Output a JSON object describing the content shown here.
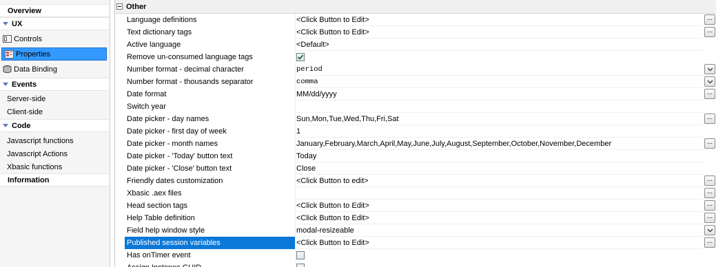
{
  "sidebar": {
    "items": [
      {
        "label": "Overview",
        "kind": "header"
      },
      {
        "label": "UX",
        "kind": "group"
      },
      {
        "label": "Controls",
        "kind": "item",
        "icon": "controls-icon"
      },
      {
        "label": "Properties",
        "kind": "item",
        "icon": "properties-icon",
        "selected": true
      },
      {
        "label": "Data Binding",
        "kind": "item",
        "icon": "database-icon"
      },
      {
        "label": "Events",
        "kind": "group"
      },
      {
        "label": "Server-side",
        "kind": "item"
      },
      {
        "label": "Client-side",
        "kind": "item"
      },
      {
        "label": "Code",
        "kind": "group"
      },
      {
        "label": "Javascript functions",
        "kind": "item"
      },
      {
        "label": "Javascript Actions",
        "kind": "item"
      },
      {
        "label": "Xbasic functions",
        "kind": "item"
      },
      {
        "label": "Information",
        "kind": "header"
      }
    ]
  },
  "grid": {
    "section_title": "Other",
    "rows": [
      {
        "name": "Language definitions",
        "value": "<Click Button to Edit>",
        "control": "ellipsis"
      },
      {
        "name": "Text dictionary tags",
        "value": "<Click Button to Edit>",
        "control": "ellipsis"
      },
      {
        "name": "Active language",
        "value": "<Default>",
        "control": "none"
      },
      {
        "name": "Remove un-consumed language tags",
        "value": "",
        "control": "checkbox",
        "checked": true
      },
      {
        "name": "Number format - decimal character",
        "value": "period",
        "control": "dropdown",
        "mono": true
      },
      {
        "name": "Number format - thousands separator",
        "value": "comma",
        "control": "dropdown",
        "mono": true
      },
      {
        "name": "Date format",
        "value": "MM/dd/yyyy",
        "control": "ellipsis"
      },
      {
        "name": "Switch year",
        "value": "",
        "control": "none"
      },
      {
        "name": "Date picker - day names",
        "value": "Sun,Mon,Tue,Wed,Thu,Fri,Sat",
        "control": "ellipsis"
      },
      {
        "name": "Date picker - first day of week",
        "value": "1",
        "control": "none"
      },
      {
        "name": "Date picker - month names",
        "value": "January,February,March,April,May,June,July,August,September,October,November,December",
        "control": "ellipsis"
      },
      {
        "name": "Date picker - 'Today' button text",
        "value": "Today",
        "control": "none"
      },
      {
        "name": "Date picker - 'Close' button text",
        "value": "Close",
        "control": "none"
      },
      {
        "name": "Friendly dates customization",
        "value": "<Click Button to edit>",
        "control": "ellipsis"
      },
      {
        "name": "Xbasic .aex files",
        "value": "",
        "control": "ellipsis"
      },
      {
        "name": "Head section tags",
        "value": "<Click Button to Edit>",
        "control": "ellipsis"
      },
      {
        "name": "Help Table definition",
        "value": "<Click Button to Edit>",
        "control": "ellipsis"
      },
      {
        "name": "Field help window style",
        "value": "modal-resizeable",
        "control": "dropdown"
      },
      {
        "name": "Published session variables",
        "value": "<Click Button to Edit>",
        "control": "ellipsis",
        "selected": true
      },
      {
        "name": "Has onTimer event",
        "value": "",
        "control": "checkbox",
        "checked": false
      },
      {
        "name": "Assign Instance GUID",
        "value": "",
        "control": "checkbox",
        "checked": false
      }
    ]
  },
  "labels": {
    "ellipsis": "..."
  },
  "colors": {
    "selection": "#0a78d7",
    "sidebar_selection": "#3399ff",
    "group_triangle": "#5a78b8"
  }
}
